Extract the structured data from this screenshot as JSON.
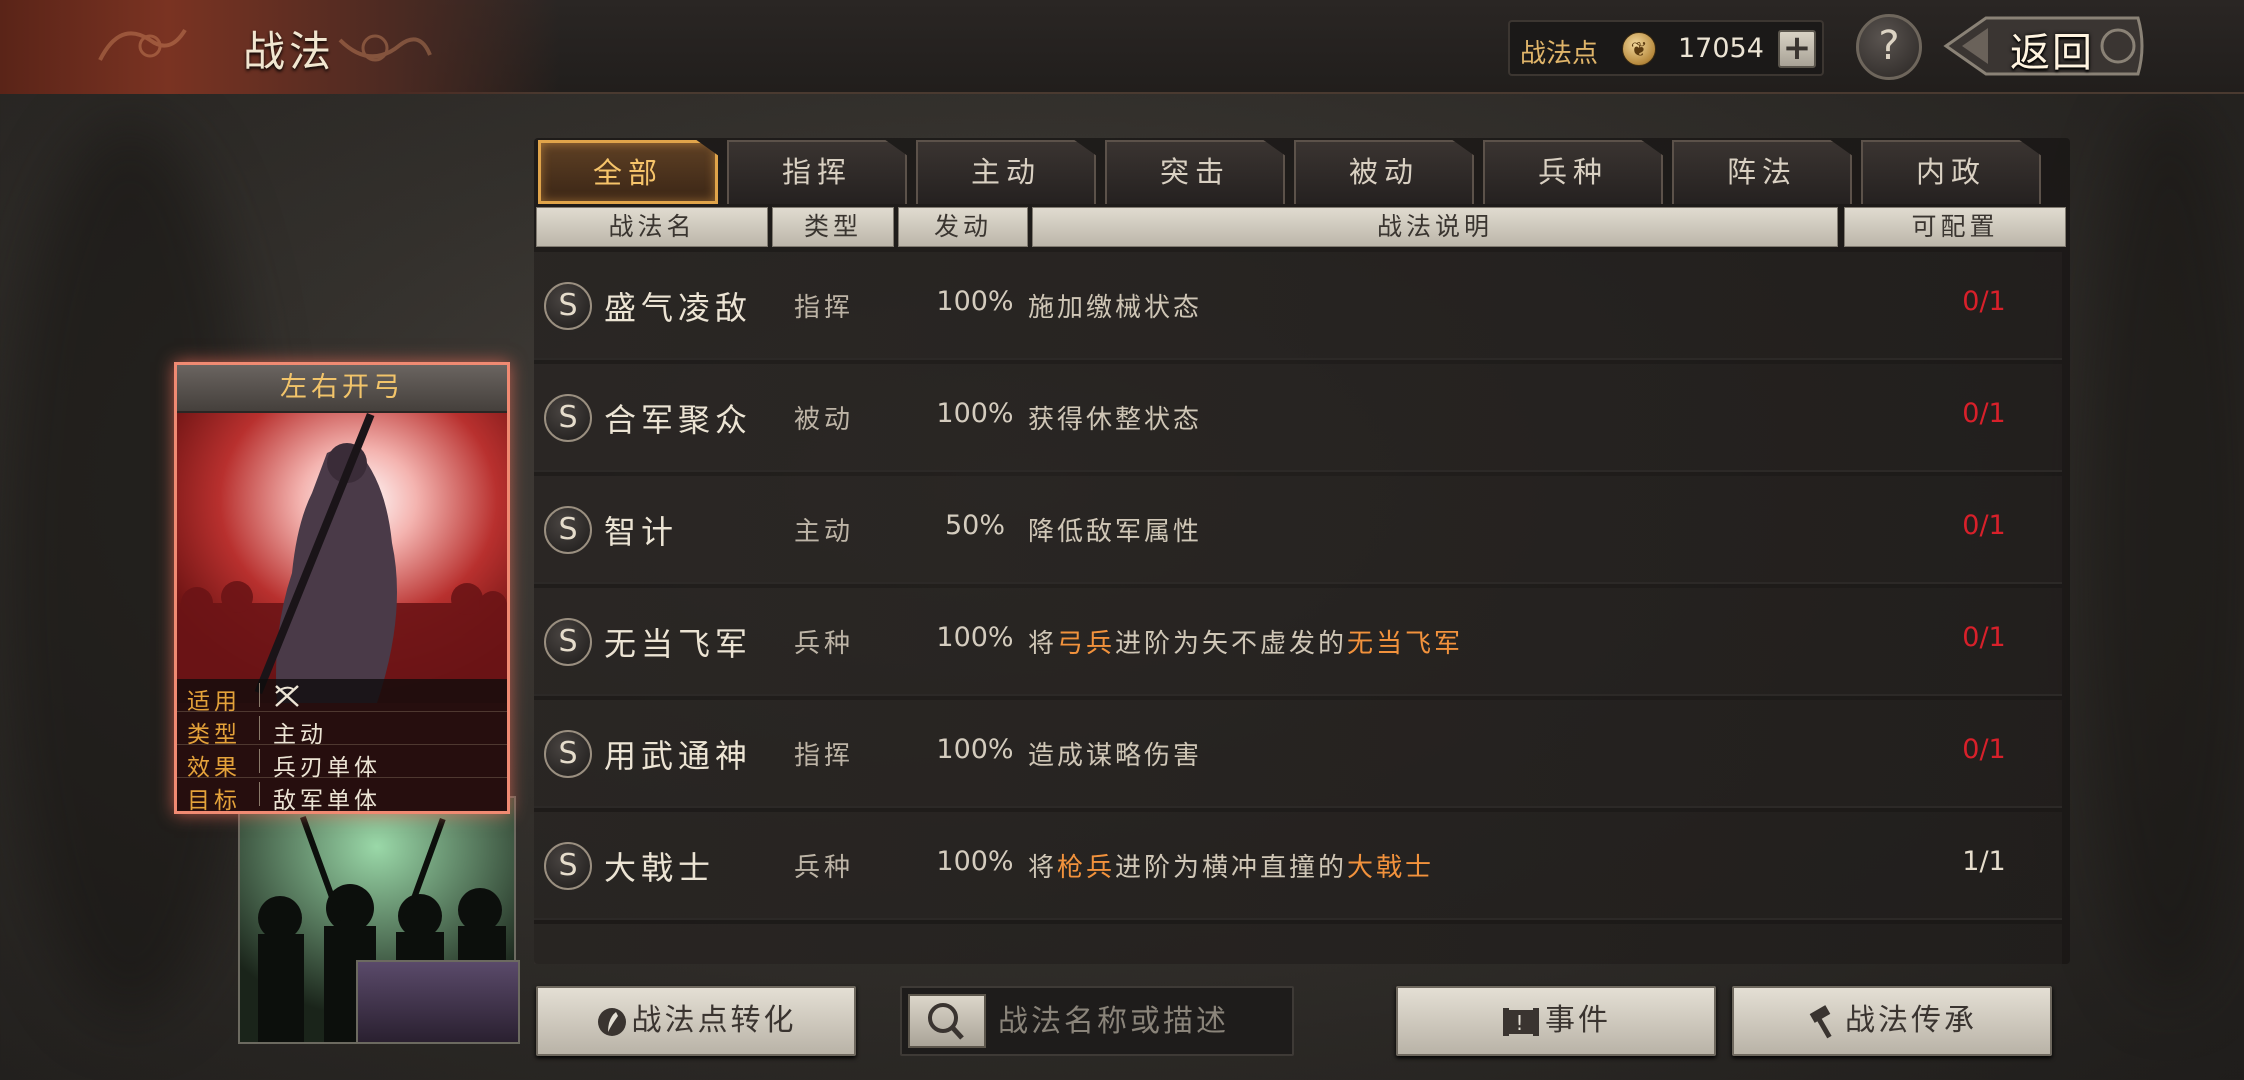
{
  "header": {
    "title": "战法",
    "points_label": "战法点",
    "points_value": "17054",
    "plus_label": "+",
    "help_label": "?",
    "back_label": "返回"
  },
  "tabs": [
    {
      "label": "全部",
      "active": true
    },
    {
      "label": "指挥"
    },
    {
      "label": "主动"
    },
    {
      "label": "突击"
    },
    {
      "label": "被动"
    },
    {
      "label": "兵种"
    },
    {
      "label": "阵法"
    },
    {
      "label": "内政"
    }
  ],
  "columns": {
    "name": "战法名",
    "type": "类型",
    "rate": "发动",
    "desc": "战法说明",
    "slots": "可配置"
  },
  "skills": [
    {
      "grade": "S",
      "name": "盛气凌敌",
      "type": "指挥",
      "rate": "100%",
      "desc": [
        "施加缴械状态"
      ],
      "slots": "0/1",
      "slots_full": true
    },
    {
      "grade": "S",
      "name": "合军聚众",
      "type": "被动",
      "rate": "100%",
      "desc": [
        "获得休整状态"
      ],
      "slots": "0/1",
      "slots_full": true
    },
    {
      "grade": "S",
      "name": "智计",
      "type": "主动",
      "rate": "50%",
      "desc": [
        "降低敌军属性"
      ],
      "slots": "0/1",
      "slots_full": true
    },
    {
      "grade": "S",
      "name": "无当飞军",
      "type": "兵种",
      "rate": "100%",
      "desc": [
        "将",
        "弓兵",
        "进阶为矢不虚发的",
        "无当飞军"
      ],
      "slots": "0/1",
      "slots_full": true
    },
    {
      "grade": "S",
      "name": "用武通神",
      "type": "指挥",
      "rate": "100%",
      "desc": [
        "造成谋略伤害"
      ],
      "slots": "0/1",
      "slots_full": true
    },
    {
      "grade": "S",
      "name": "大戟士",
      "type": "兵种",
      "rate": "100%",
      "desc": [
        "将",
        "枪兵",
        "进阶为横冲直撞的",
        "大戟士"
      ],
      "slots": "1/1",
      "slots_full": false
    }
  ],
  "card": {
    "title": "左右开弓",
    "rows": [
      {
        "key": "适用",
        "value": "",
        "icon": "crossed-weapons-icon"
      },
      {
        "key": "类型",
        "value": "主动"
      },
      {
        "key": "效果",
        "value": "兵刃单体"
      },
      {
        "key": "目标",
        "value": "敌军单体"
      }
    ]
  },
  "footer": {
    "convert_label": "战法点转化",
    "search_placeholder": "战法名称或描述",
    "event_label": "事件",
    "inherit_label": "战法传承"
  },
  "colors": {
    "accent_orange": "#f2923c",
    "slots_red": "#d8202a",
    "tab_active": "#e0a44a"
  }
}
